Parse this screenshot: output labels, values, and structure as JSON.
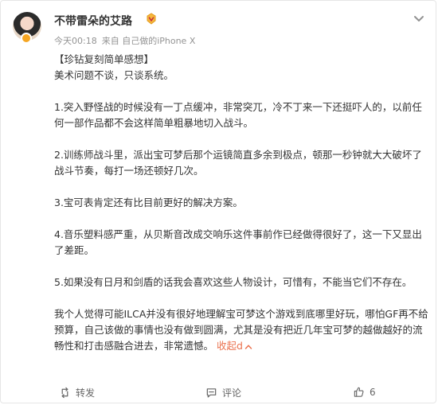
{
  "post": {
    "username": "不带雷朵的艾路",
    "time": "今天00:18",
    "source": "来自 自己做的iPhone X",
    "title": "【珍钻复刻简单感想】",
    "intro": "美术问题不谈，只谈系统。",
    "points": [
      {
        "text": "1.突入野怪战的时候没有一丁点缓冲，非常突兀，冷不丁来一下还挺吓人的，以前任何一部作品都不会这样简单粗暴地切入战斗。"
      },
      {
        "text": "2.训练师战斗里，派出宝可梦后那个运镜简直多余到极点，顿那一秒钟就大大破坏了战斗节奏，每打一场还顿好几次。"
      },
      {
        "text": "3.宝可表肯定还有比目前更好的解决方案。"
      },
      {
        "text": "4.音乐塑料感严重，从贝斯音改成交响乐这件事前作已经做得很好了，这一下又显出了差距。"
      },
      {
        "text": "5.如果没有日月和剑盾的话我会喜欢这些人物设计，可惜有，不能当它们不存在。"
      }
    ],
    "conclusion": "我个人觉得可能ILCA并没有很好地理解宝可梦这个游戏到底哪里好玩，哪怕GF再不给预算，自己该做的事情也没有做到圆满，尤其是没有把近几年宝可梦的越做越好的流畅性和打击感融合进去，非常遗憾。",
    "collapse_label": "收起d"
  },
  "footer": {
    "repost_label": "转发",
    "comment_label": "评论",
    "like_count": "6"
  },
  "colors": {
    "accent": "#eb7350",
    "meta": "#939393"
  },
  "icons": {
    "vip": "vip-badge-icon",
    "more": "chevron-down-icon",
    "repost": "repost-icon",
    "comment": "comment-icon",
    "like": "thumbs-up-icon"
  }
}
